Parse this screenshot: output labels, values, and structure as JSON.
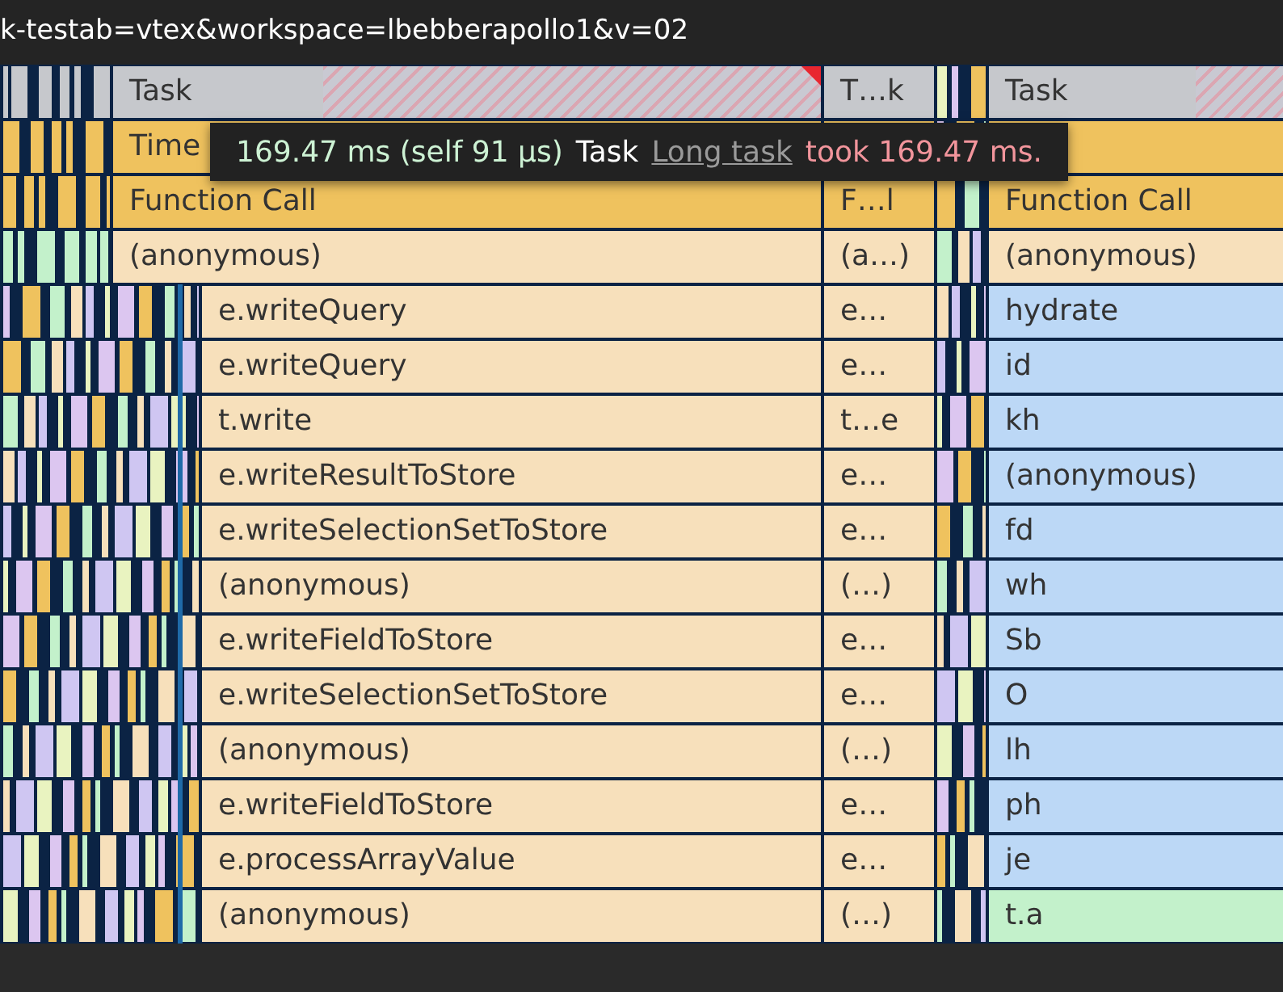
{
  "url_bar": {
    "text": "k-testab=vtex&workspace=lbebberapollo1&v=02"
  },
  "tooltip": {
    "duration": "169.47 ms (self 91 μs)",
    "name": "Task",
    "link": "Long task",
    "warning": "took 169.47 ms."
  },
  "rows": [
    {
      "main": {
        "text": "Task",
        "kind": "task",
        "long_task": true
      },
      "middle": {
        "text": "T…k",
        "kind": "task"
      },
      "right": {
        "text": "Task",
        "kind": "task",
        "long_task": true
      }
    },
    {
      "main": {
        "text": "Time",
        "kind": "timer"
      },
      "middle": {
        "kind": "timer"
      },
      "right": {
        "kind": "timer"
      }
    },
    {
      "main": {
        "text": "Function Call",
        "kind": "timer"
      },
      "middle": {
        "text": "F…l",
        "kind": "timer"
      },
      "right": {
        "text": "Function Call",
        "kind": "timer"
      }
    },
    {
      "main": {
        "text": "(anonymous)",
        "kind": "script"
      },
      "middle": {
        "text": "(a…)",
        "kind": "script"
      },
      "right": {
        "text": "(anonymous)",
        "kind": "script"
      }
    },
    {
      "main": {
        "text": "e.writeQuery",
        "kind": "script"
      },
      "middle": {
        "text": "e…",
        "kind": "script"
      },
      "right": {
        "text": "hydrate",
        "kind": "js"
      }
    },
    {
      "main": {
        "text": "e.writeQuery",
        "kind": "script"
      },
      "middle": {
        "text": "e…",
        "kind": "script"
      },
      "right": {
        "text": "id",
        "kind": "js"
      }
    },
    {
      "main": {
        "text": "t.write",
        "kind": "script"
      },
      "middle": {
        "text": "t…e",
        "kind": "script"
      },
      "right": {
        "text": "kh",
        "kind": "js"
      }
    },
    {
      "main": {
        "text": "e.writeResultToStore",
        "kind": "script"
      },
      "middle": {
        "text": "e…",
        "kind": "script"
      },
      "right": {
        "text": "(anonymous)",
        "kind": "js"
      }
    },
    {
      "main": {
        "text": "e.writeSelectionSetToStore",
        "kind": "script"
      },
      "middle": {
        "text": "e…",
        "kind": "script"
      },
      "right": {
        "text": "fd",
        "kind": "js"
      }
    },
    {
      "main": {
        "text": "(anonymous)",
        "kind": "script"
      },
      "middle": {
        "text": "(…)",
        "kind": "script"
      },
      "right": {
        "text": "wh",
        "kind": "js"
      }
    },
    {
      "main": {
        "text": "e.writeFieldToStore",
        "kind": "script"
      },
      "middle": {
        "text": "e…",
        "kind": "script"
      },
      "right": {
        "text": "Sb",
        "kind": "js"
      }
    },
    {
      "main": {
        "text": "e.writeSelectionSetToStore",
        "kind": "script"
      },
      "middle": {
        "text": "e…",
        "kind": "script"
      },
      "right": {
        "text": "O",
        "kind": "js"
      }
    },
    {
      "main": {
        "text": "(anonymous)",
        "kind": "script"
      },
      "middle": {
        "text": "(…)",
        "kind": "script"
      },
      "right": {
        "text": "lh",
        "kind": "js"
      }
    },
    {
      "main": {
        "text": "e.writeFieldToStore",
        "kind": "script"
      },
      "middle": {
        "text": "e…",
        "kind": "script"
      },
      "right": {
        "text": "ph",
        "kind": "js"
      }
    },
    {
      "main": {
        "text": "e.processArrayValue",
        "kind": "script"
      },
      "middle": {
        "text": "e…",
        "kind": "script"
      },
      "right": {
        "text": "je",
        "kind": "js"
      }
    },
    {
      "main": {
        "text": "(anonymous)",
        "kind": "script"
      },
      "middle": {
        "text": "(…)",
        "kind": "script"
      },
      "right": {
        "text": "t.a",
        "kind": "green"
      }
    }
  ]
}
